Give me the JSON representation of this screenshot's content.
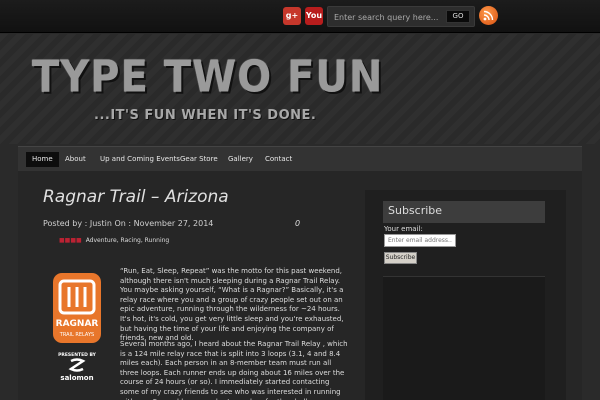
{
  "topbar": {
    "search_placeholder": "Enter search query here...",
    "go_label": "GO",
    "social_icons": [
      "google-plus-icon",
      "youtube-icon",
      "rss-icon"
    ],
    "gplus_glyph": "g+",
    "youtube_glyph": "You"
  },
  "header": {
    "logo_title": "TYPE TWO FUN",
    "logo_tagline": "...IT'S FUN WHEN IT'S DONE."
  },
  "nav": {
    "items": [
      "Home",
      "About",
      "Up and Coming Events",
      "Gear Store",
      "Gallery",
      "Contact"
    ],
    "active": "Home"
  },
  "post": {
    "title": "Ragnar Trail – Arizona",
    "meta": "Posted by : Justin  On :  November 27, 2014",
    "comments": "0",
    "tags": "Adventure, Racing, Running",
    "paragraph1": "“Run, Eat, Sleep, Repeat” was the motto for this past weekend, although there isn't much sleeping during a Ragnar Trail Relay.  You maybe asking yourself, “What is a Ragnar?”  Basically, it's a relay race where you and a group of crazy people set out on an epic adventure, running through the wilderness for ~24 hours.  It's hot, it's cold, you get very little sleep and you're exhausted, but having the time of your life and enjoying the company of friends, new and old.",
    "paragraph2": "Several months ago, I heard about the Ragnar Trail Relay , which is a 124 mile relay race that is split into 3 loops (3.1, 4 and 8.4 miles each). Each person in an 8-member team must run all three loops.  Each runner ends up doing about 16 miles over the course of 24 hours (or so).  I immediately started contacting some of my crazy friends to see who was interested in running with me.  Several brave souls stepped up for the challenge"
  },
  "ragnar_logo": {
    "name": "RAGNAR",
    "sub": "TRAIL RELAYS",
    "presented": "PRESENTED BY",
    "sponsor": "salomon"
  },
  "sidebar": {
    "subscribe_title": "Subscribe",
    "email_label": "Your email:",
    "email_placeholder": "Enter email address...",
    "subscribe_button": "Subscribe"
  },
  "colors": {
    "background": "#2a2a2a",
    "ragnar_orange": "#e8762b",
    "rss_orange": "#e8651e"
  }
}
